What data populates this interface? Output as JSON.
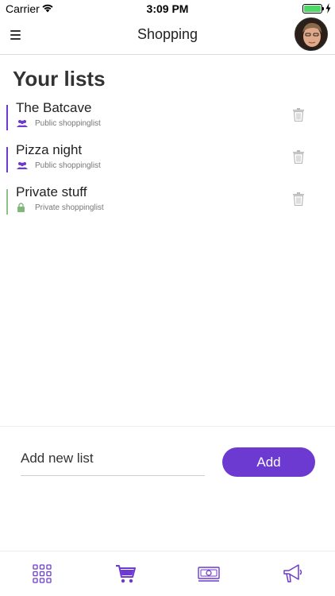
{
  "status_bar": {
    "carrier": "Carrier",
    "time": "3:09 PM"
  },
  "nav": {
    "title": "Shopping"
  },
  "page": {
    "title": "Your lists"
  },
  "colors": {
    "accent": "#6c3ad0",
    "public_bar": "#6c3ad0",
    "private_bar": "#8fbf8a",
    "private_icon": "#7fb87a"
  },
  "lists": [
    {
      "name": "The Batcave",
      "type_label": "Public shoppinglist",
      "icon": "group-icon"
    },
    {
      "name": "Pizza night",
      "type_label": "Public shoppinglist",
      "icon": "group-icon"
    },
    {
      "name": "Private stuff",
      "type_label": "Private shoppinglist",
      "icon": "lock-icon"
    }
  ],
  "add": {
    "placeholder": "Add new list",
    "button_label": "Add"
  },
  "tabs": [
    {
      "icon": "grid-icon"
    },
    {
      "icon": "cart-icon",
      "active": true
    },
    {
      "icon": "money-icon"
    },
    {
      "icon": "megaphone-icon"
    }
  ]
}
